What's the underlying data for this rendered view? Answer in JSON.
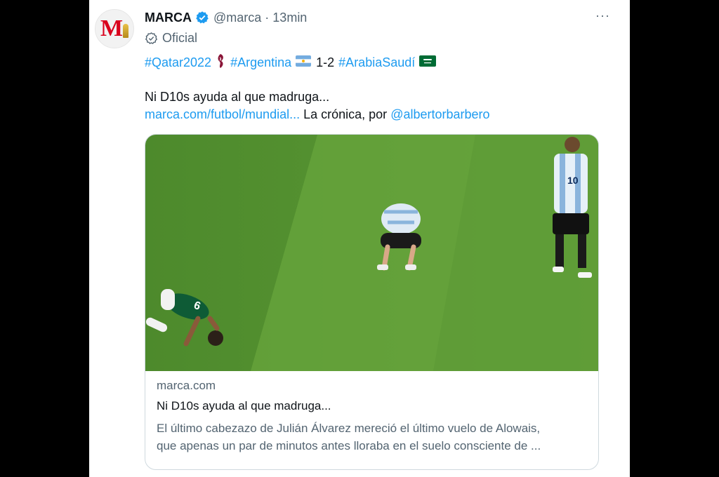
{
  "tweet": {
    "name": "MARCA",
    "handle": "@marca",
    "separator": "·",
    "time": "13min",
    "more": "···",
    "official_label": "Oficial",
    "hashtag_qatar": "#Qatar2022",
    "hashtag_argentina": "#Argentina",
    "score": "1-2",
    "hashtag_arabia": "#ArabiaSaudí",
    "text_main": "Ni D10s ayuda al que madruga...",
    "link_url": "marca.com/futbol/mundial...",
    "text_cronica": "La crónica, por",
    "mention": "@albertorbarbero"
  },
  "card": {
    "domain": "marca.com",
    "title": "Ni D10s ayuda al que madruga...",
    "description_line1": "El último cabezazo de Julián Álvarez mereció el último vuelo de Alowais,",
    "description_line2": "que apenas un par de minutos antes lloraba en el suelo consciente de ..."
  },
  "icons": [
    "verified-badge-icon",
    "official-check-icon",
    "more-options-icon",
    "qatar-trophy-emoji-icon",
    "argentina-flag-icon",
    "saudi-flag-icon"
  ],
  "colors": {
    "link": "#1d9bf0",
    "text": "#0f1419",
    "muted": "#536471",
    "marca_red": "#d9001d",
    "pitch_green": "#5e9a36"
  }
}
